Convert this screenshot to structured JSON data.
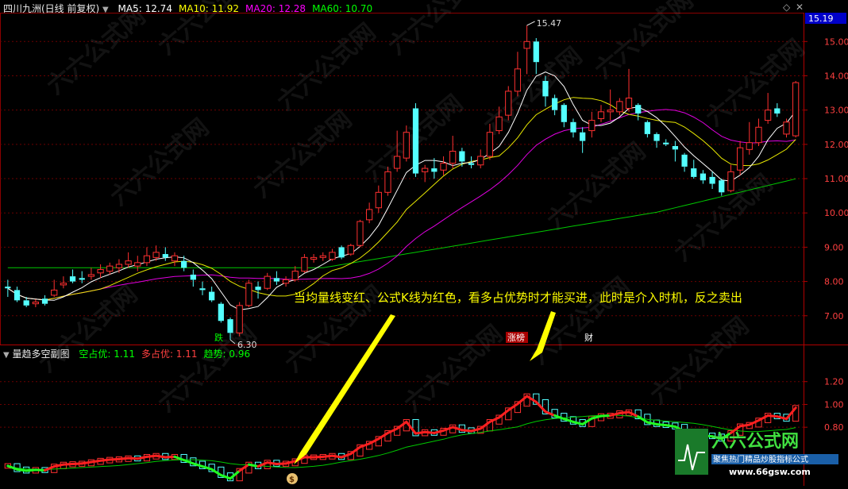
{
  "main_header": {
    "stock": "四川九洲(日线 前复权)",
    "ma_labels": [
      {
        "text": "MA5: 12.74",
        "color": "#ffffff"
      },
      {
        "text": "MA10: 11.92",
        "color": "#ffff00"
      },
      {
        "text": "MA20: 12.28",
        "color": "#ff00ff"
      },
      {
        "text": "MA60: 10.70",
        "color": "#00ff00"
      }
    ]
  },
  "sub_header": {
    "name": "量趋多空副图",
    "labels": [
      {
        "text": "空占优: 1.11",
        "color": "#00ff00"
      },
      {
        "text": "多占优: 1.11",
        "color": "#ff4040"
      },
      {
        "text": "趋势: 0.96",
        "color": "#00ff00"
      }
    ]
  },
  "current_price": "15.19",
  "annotation": "当均量线变红、公式K线为红色，看多占优势时才能买进，此时是介入时机，反之卖出",
  "markers": {
    "high": "15.47",
    "low": "6.30",
    "die": "跌",
    "zhangting": "涨榜",
    "cai": "财",
    "dollar": "$"
  },
  "watermark": {
    "brand": "六六公式网",
    "slogan": "聚焦热门精品炒股指标公式",
    "url": "www.66gsw.com"
  },
  "chart_data": {
    "type": "candlestick",
    "main_y_ticks": [
      "15.00",
      "14.00",
      "13.00",
      "12.00",
      "11.00",
      "10.00",
      "9.00",
      "8.00",
      "7.00"
    ],
    "main_ylim": [
      6.3,
      15.47
    ],
    "candles": [
      [
        7.85,
        7.8,
        8.05,
        7.55
      ],
      [
        7.75,
        7.45,
        7.85,
        7.4
      ],
      [
        7.45,
        7.3,
        7.55,
        7.25
      ],
      [
        7.35,
        7.4,
        7.48,
        7.25
      ],
      [
        7.5,
        7.35,
        7.6,
        7.3
      ],
      [
        7.6,
        7.75,
        8.05,
        7.55
      ],
      [
        7.9,
        7.95,
        8.15,
        7.8
      ],
      [
        8.15,
        8.0,
        8.35,
        7.95
      ],
      [
        8.1,
        8.05,
        8.3,
        7.95
      ],
      [
        8.15,
        8.2,
        8.4,
        8.05
      ],
      [
        8.25,
        8.35,
        8.5,
        8.1
      ],
      [
        8.3,
        8.45,
        8.55,
        8.2
      ],
      [
        8.4,
        8.5,
        8.65,
        8.25
      ],
      [
        8.5,
        8.6,
        8.85,
        8.4
      ],
      [
        8.45,
        8.55,
        8.75,
        8.3
      ],
      [
        8.55,
        8.75,
        9.0,
        8.45
      ],
      [
        8.7,
        8.85,
        9.05,
        8.6
      ],
      [
        8.8,
        8.7,
        9.0,
        8.6
      ],
      [
        8.6,
        8.75,
        8.85,
        8.45
      ],
      [
        8.6,
        8.4,
        8.75,
        8.3
      ],
      [
        8.2,
        8.05,
        8.35,
        7.85
      ],
      [
        7.8,
        7.75,
        8.0,
        7.6
      ],
      [
        7.7,
        7.45,
        7.85,
        7.4
      ],
      [
        7.35,
        6.85,
        7.4,
        6.8
      ],
      [
        6.9,
        6.5,
        6.95,
        6.3
      ],
      [
        6.5,
        7.3,
        7.4,
        6.4
      ],
      [
        7.3,
        7.95,
        8.05,
        7.25
      ],
      [
        7.85,
        7.75,
        8.0,
        7.5
      ],
      [
        7.8,
        8.15,
        8.25,
        7.75
      ],
      [
        8.1,
        8.0,
        8.3,
        7.9
      ],
      [
        7.95,
        8.05,
        8.15,
        7.85
      ],
      [
        8.05,
        8.3,
        8.45,
        8.0
      ],
      [
        8.3,
        8.7,
        8.8,
        8.25
      ],
      [
        8.65,
        8.7,
        8.8,
        8.55
      ],
      [
        8.7,
        8.75,
        8.85,
        8.6
      ],
      [
        8.65,
        8.85,
        8.95,
        8.6
      ],
      [
        9.0,
        8.7,
        9.05,
        8.65
      ],
      [
        8.8,
        9.05,
        9.1,
        8.75
      ],
      [
        9.05,
        9.75,
        9.8,
        9.0
      ],
      [
        9.8,
        10.1,
        10.3,
        9.7
      ],
      [
        10.15,
        10.6,
        10.8,
        10.0
      ],
      [
        10.6,
        11.2,
        11.35,
        10.5
      ],
      [
        11.3,
        11.65,
        12.4,
        11.2
      ],
      [
        11.6,
        12.35,
        12.55,
        11.5
      ],
      [
        13.05,
        11.15,
        13.2,
        11.05
      ],
      [
        11.2,
        11.3,
        11.4,
        10.9
      ],
      [
        11.3,
        11.2,
        11.6,
        11.0
      ],
      [
        11.25,
        11.45,
        11.65,
        11.1
      ],
      [
        11.45,
        11.8,
        12.25,
        11.3
      ],
      [
        11.8,
        11.5,
        11.9,
        11.35
      ],
      [
        11.45,
        11.4,
        11.65,
        11.3
      ],
      [
        11.4,
        11.65,
        11.85,
        11.3
      ],
      [
        11.65,
        12.35,
        12.6,
        11.55
      ],
      [
        12.4,
        12.8,
        13.1,
        12.3
      ],
      [
        12.85,
        13.55,
        13.7,
        12.7
      ],
      [
        13.55,
        14.2,
        14.7,
        13.4
      ],
      [
        14.8,
        15.0,
        15.47,
        14.05
      ],
      [
        15.0,
        14.4,
        15.1,
        14.05
      ],
      [
        13.85,
        13.4,
        14.0,
        13.1
      ],
      [
        13.35,
        13.0,
        13.45,
        12.85
      ],
      [
        13.15,
        12.65,
        13.2,
        12.5
      ],
      [
        12.65,
        12.35,
        12.75,
        12.2
      ],
      [
        12.35,
        12.1,
        12.5,
        11.75
      ],
      [
        12.4,
        12.7,
        12.95,
        12.2
      ],
      [
        12.75,
        12.95,
        13.15,
        12.65
      ],
      [
        12.95,
        13.0,
        13.6,
        12.7
      ],
      [
        12.95,
        13.25,
        13.35,
        12.85
      ],
      [
        13.05,
        13.35,
        14.2,
        12.95
      ],
      [
        13.15,
        12.9,
        13.2,
        12.7
      ],
      [
        12.65,
        12.3,
        12.7,
        12.2
      ],
      [
        12.3,
        12.1,
        12.35,
        11.9
      ],
      [
        12.05,
        12.0,
        12.15,
        11.95
      ],
      [
        11.95,
        11.85,
        12.1,
        11.5
      ],
      [
        11.7,
        11.35,
        11.75,
        11.2
      ],
      [
        11.3,
        11.05,
        11.55,
        11.0
      ],
      [
        11.15,
        10.95,
        11.25,
        10.85
      ],
      [
        11.05,
        10.85,
        11.2,
        10.7
      ],
      [
        10.95,
        10.6,
        11.0,
        10.5
      ],
      [
        10.65,
        11.2,
        11.4,
        10.6
      ],
      [
        11.25,
        11.9,
        12.1,
        11.1
      ],
      [
        11.85,
        12.05,
        12.65,
        11.7
      ],
      [
        12.05,
        12.5,
        12.75,
        11.95
      ],
      [
        12.7,
        13.0,
        13.5,
        12.6
      ],
      [
        13.05,
        12.9,
        13.2,
        12.8
      ],
      [
        12.3,
        12.65,
        12.75,
        12.2
      ],
      [
        12.25,
        13.8,
        13.85,
        12.2
      ]
    ],
    "sub_y_ticks": [
      "1.20",
      "1.00",
      "0.80"
    ],
    "sub_ylim": [
      0.3,
      1.4
    ]
  }
}
